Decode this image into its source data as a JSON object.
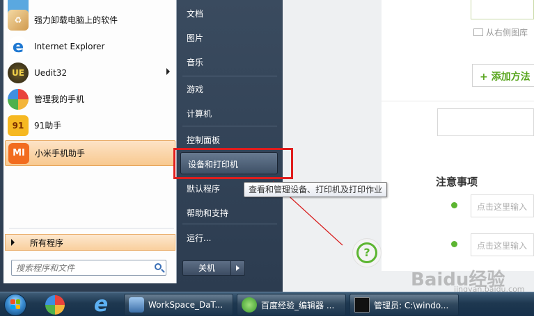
{
  "background_page": {
    "image_hint": "从右侧图库",
    "add_method_button": "+ 添加方法",
    "notes_title": "注意事项",
    "note_placeholder": "点击这里输入",
    "help_icon": "?",
    "watermark_logo": "Baidu经验",
    "watermark_url": "jingyan.baidu.com"
  },
  "start_menu": {
    "programs": [
      {
        "label": "强力卸载电脑上的软件",
        "icon": "uninstall-icon"
      },
      {
        "label": "Internet Explorer",
        "icon": "ie-icon"
      },
      {
        "label": "Uedit32",
        "icon": "uedit-icon",
        "has_submenu": true
      },
      {
        "label": "管理我的手机",
        "icon": "phone-manager-icon"
      },
      {
        "label": "91助手",
        "icon": "91-assistant-icon"
      },
      {
        "label": "小米手机助手",
        "icon": "mi-icon",
        "selected": true
      }
    ],
    "all_programs": "所有程序",
    "search_placeholder": "搜索程序和文件",
    "right_items": [
      "文档",
      "图片",
      "音乐",
      "游戏",
      "计算机",
      "控制面板",
      "设备和打印机",
      "默认程序",
      "帮助和支持",
      "运行..."
    ],
    "highlighted_item": "设备和打印机",
    "shutdown": "关机",
    "tooltip": "查看和管理设备、打印机及打印作业"
  },
  "taskbar": {
    "windows": [
      {
        "label": "WorkSpace_DaT..."
      },
      {
        "label": "百度经验_编辑器 ..."
      },
      {
        "label": "管理员: C:\\windo..."
      }
    ]
  },
  "colors": {
    "highlight_box": "#e01d1d",
    "accent_green": "#5cb531"
  }
}
